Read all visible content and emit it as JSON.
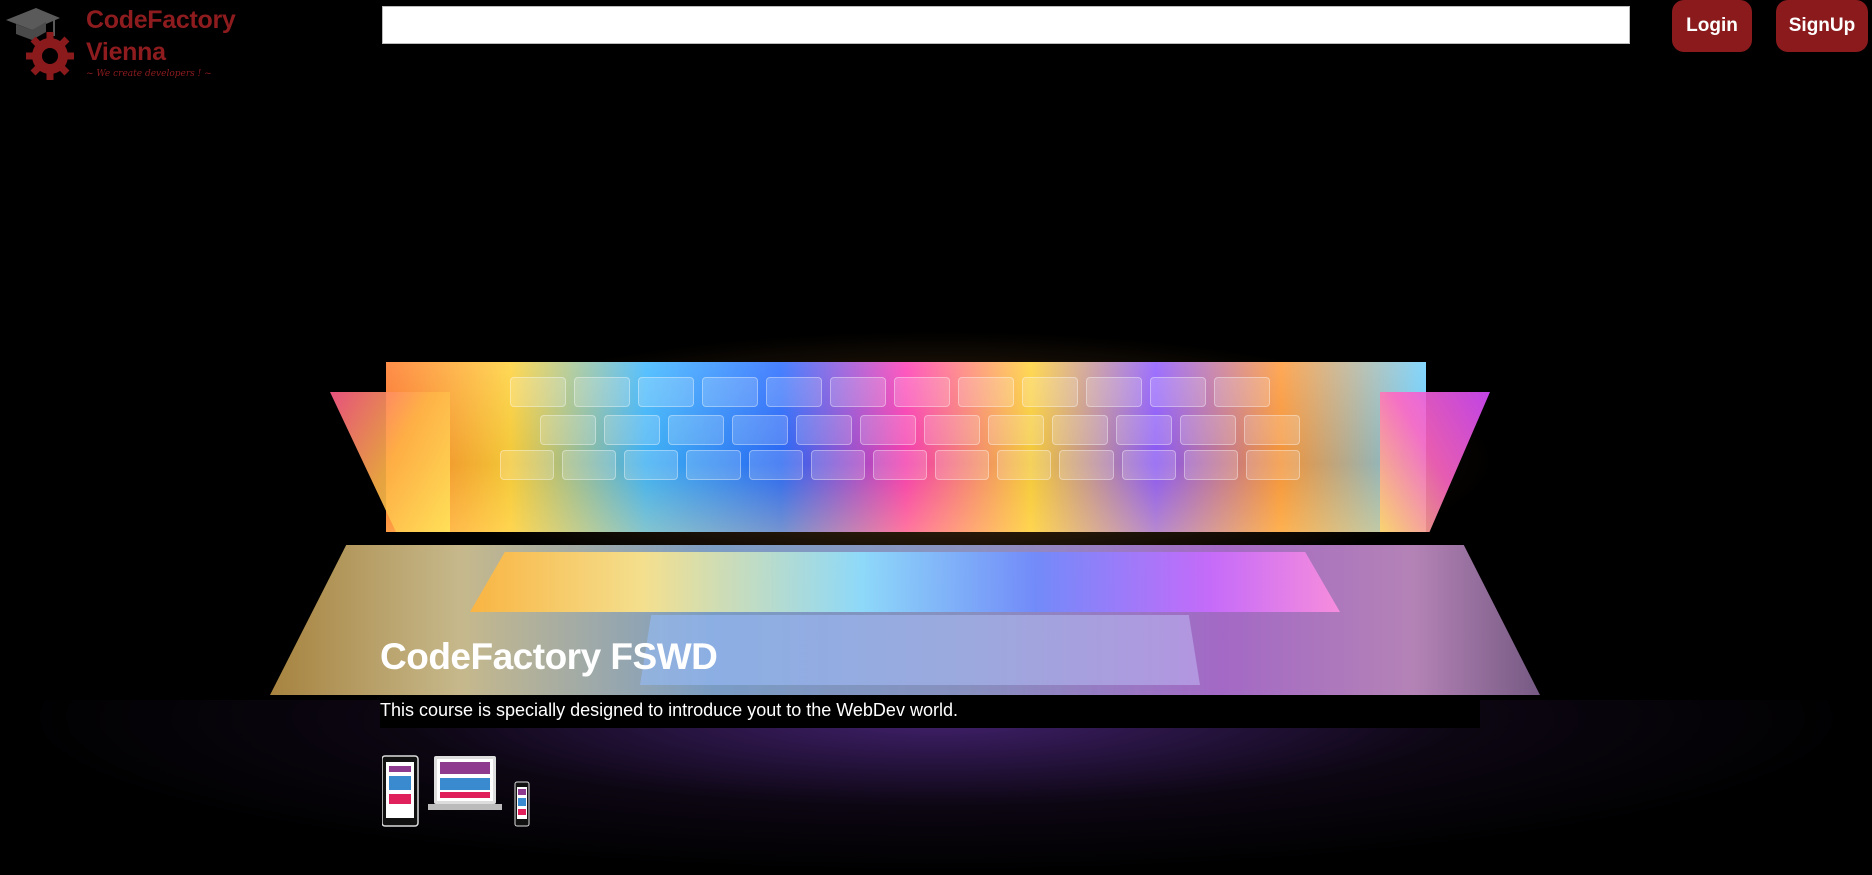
{
  "logo": {
    "line1": "CodeFactory",
    "line2": "Vienna",
    "tagline": "~ We create developers ! ~"
  },
  "search": {
    "value": "",
    "placeholder": ""
  },
  "buttons": {
    "login": "Login",
    "signup": "SignUp"
  },
  "hero": {
    "title": "CodeFactory FSWD",
    "description": "This course is specially designed to introduce yout to the WebDev world."
  },
  "colors": {
    "brand": "#8b1a1d",
    "background": "#000000",
    "text": "#ffffff"
  },
  "icons": {
    "logo": "graduation-cap-gear-icon",
    "devices": "responsive-devices-icon"
  }
}
